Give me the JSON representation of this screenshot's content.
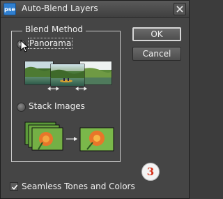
{
  "window": {
    "title": "Auto-Blend Layers",
    "app_icon_text": "pse"
  },
  "blend_method": {
    "group_title": "Blend Method",
    "options": [
      {
        "label": "Panorama",
        "selected": true
      },
      {
        "label": "Stack Images",
        "selected": false
      }
    ]
  },
  "buttons": {
    "ok_label": "OK",
    "cancel_label": "Cancel"
  },
  "seamless": {
    "label": "Seamless Tones and Colors",
    "checked": true
  },
  "badge": {
    "text": "3",
    "color": "#d63018"
  },
  "colors": {
    "window_bg": "#454545",
    "title_bg": "#4b4b4b",
    "accent_icon": "#2f7fd0"
  }
}
